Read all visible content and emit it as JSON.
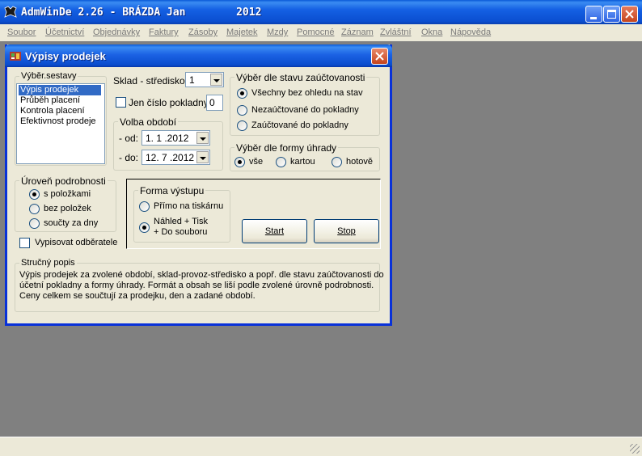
{
  "window": {
    "title": "AdmWinDe 2.26 - BRÁZDA Jan        2012"
  },
  "menu": [
    "Soubor",
    "Účetnictví",
    "Objednávky",
    "Faktury",
    "Zásoby",
    "Majetek",
    "Mzdy",
    "Pomocné",
    "Záznam",
    "Zvláštní",
    "Okna",
    "Nápověda"
  ],
  "dialog": {
    "title": "Výpisy prodejek",
    "vyber_sestavy": {
      "legend": "Výběr.sestavy",
      "items": [
        "Výpis prodejek",
        "Průběh placení",
        "Kontrola placení",
        "Efektivnost prodeje"
      ],
      "selected": "Výpis prodejek"
    },
    "sklad": {
      "label": "Sklad - středisko:",
      "value": "1"
    },
    "jen_cislo": {
      "label": "Jen číslo pokladny:",
      "checked": false,
      "value": "0"
    },
    "volba_obdobi": {
      "legend": "Volba období",
      "od_label": "- od:",
      "od_value": "1. 1 .2012",
      "do_label": "- do:",
      "do_value": "12. 7 .2012"
    },
    "stav_zauctovani": {
      "legend": "Výběr dle stavu zaúčtovanosti",
      "options": [
        "Všechny bez ohledu na stav",
        "Nezaúčtované do pokladny",
        "Zaúčtované do pokladny"
      ],
      "selected": "Všechny bez ohledu na stav"
    },
    "forma_uhrady": {
      "legend": "Výběr dle formy úhrady",
      "options": [
        "vše",
        "kartou",
        "hotově"
      ],
      "selected": "vše"
    },
    "uroven": {
      "legend": "Úroveň podrobnosti",
      "options": [
        "s položkami",
        "bez položek",
        "součty za dny"
      ],
      "selected": "s položkami"
    },
    "vypisovat": {
      "label": "Vypisovat odběratele",
      "checked": false
    },
    "forma_vystupu": {
      "legend": "Forma výstupu",
      "option1": "Přímo na tiskárnu",
      "option2_line1": "Náhled + Tisk",
      "option2_line2": "+ Do souboru",
      "selected": "Náhled + Tisk + Do souboru"
    },
    "buttons": {
      "start": "Start",
      "stop": "Stop"
    },
    "popis": {
      "legend": "Stručný popis",
      "line1": "Výpis prodejek za zvolené období, sklad-provoz-středisko a popř. dle stavu zaúčtovanosti do",
      "line2": "účetní pokladny a formy úhrady. Formát a obsah se liší podle zvolené úrovně podrobnosti.",
      "line3": "Ceny celkem se součtují za prodejku, den a zadané období."
    }
  }
}
